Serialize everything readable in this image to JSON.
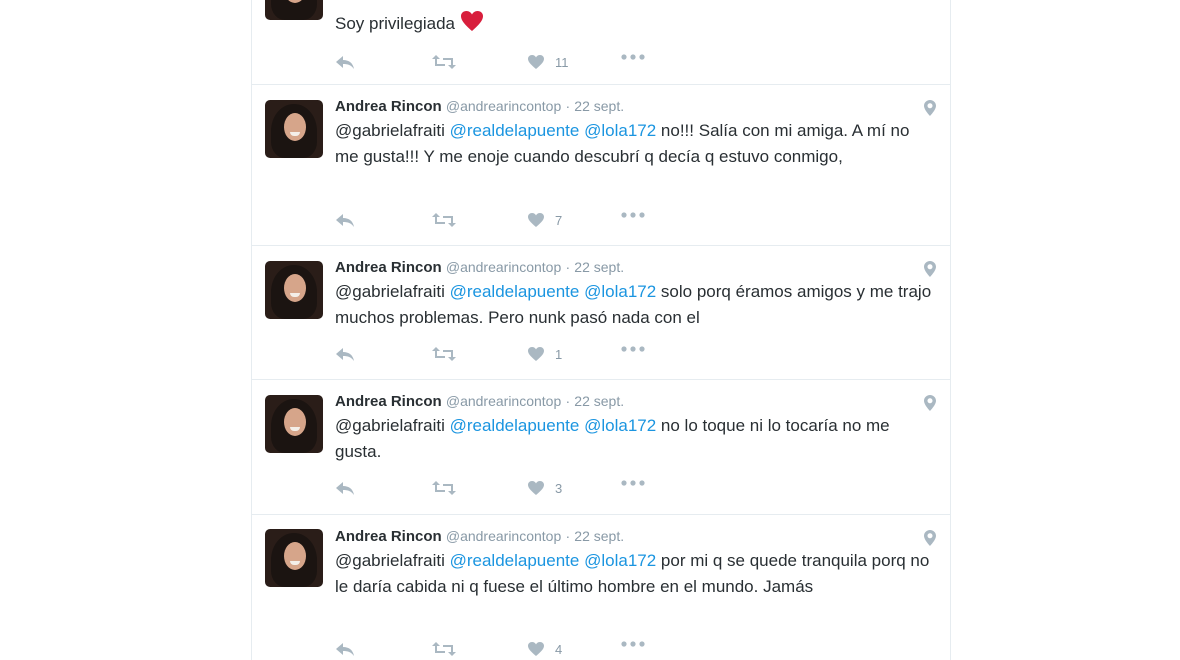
{
  "first_tweet": {
    "text": "Soy privilegiada",
    "likes": "11"
  },
  "tweets": [
    {
      "name": "Andrea Rincon",
      "handle": "@andrearincontop",
      "date": "22 sept.",
      "mention1": "@gabrielafraiti",
      "mention2": "@realdelapuente",
      "mention3": "@lola172",
      "body": "no!!! Salía con mi amiga. A mí no me gusta!!! Y me enoje cuando descubrí q decía q estuvo conmigo,",
      "likes": "7"
    },
    {
      "name": "Andrea Rincon",
      "handle": "@andrearincontop",
      "date": "22 sept.",
      "mention1": "@gabrielafraiti",
      "mention2": "@realdelapuente",
      "mention3": "@lola172",
      "body": "solo porq éramos amigos y me trajo muchos problemas. Pero nunk pasó nada con el",
      "likes": "1"
    },
    {
      "name": "Andrea Rincon",
      "handle": "@andrearincontop",
      "date": "22 sept.",
      "mention1": "@gabrielafraiti",
      "mention2": "@realdelapuente",
      "mention3": "@lola172",
      "body": "no lo toque ni lo tocaría no me gusta.",
      "likes": "3"
    },
    {
      "name": "Andrea Rincon",
      "handle": "@andrearincontop",
      "date": "22 sept.",
      "mention1": "@gabrielafraiti",
      "mention2": "@realdelapuente",
      "mention3": "@lola172",
      "body": "por mi q se quede tranquila porq no le daría cabida ni q fuese el último hombre en el mundo. Jamás",
      "likes": "4"
    }
  ],
  "colors": {
    "mention": "#1b95e0",
    "icon": "#aab8c2",
    "heart_emoji": "#e0245e",
    "divider": "#e6ecf0"
  },
  "icons": [
    "reply-icon",
    "retweet-icon",
    "like-icon",
    "more-icon",
    "location-pin-icon",
    "red-heart-emoji"
  ]
}
